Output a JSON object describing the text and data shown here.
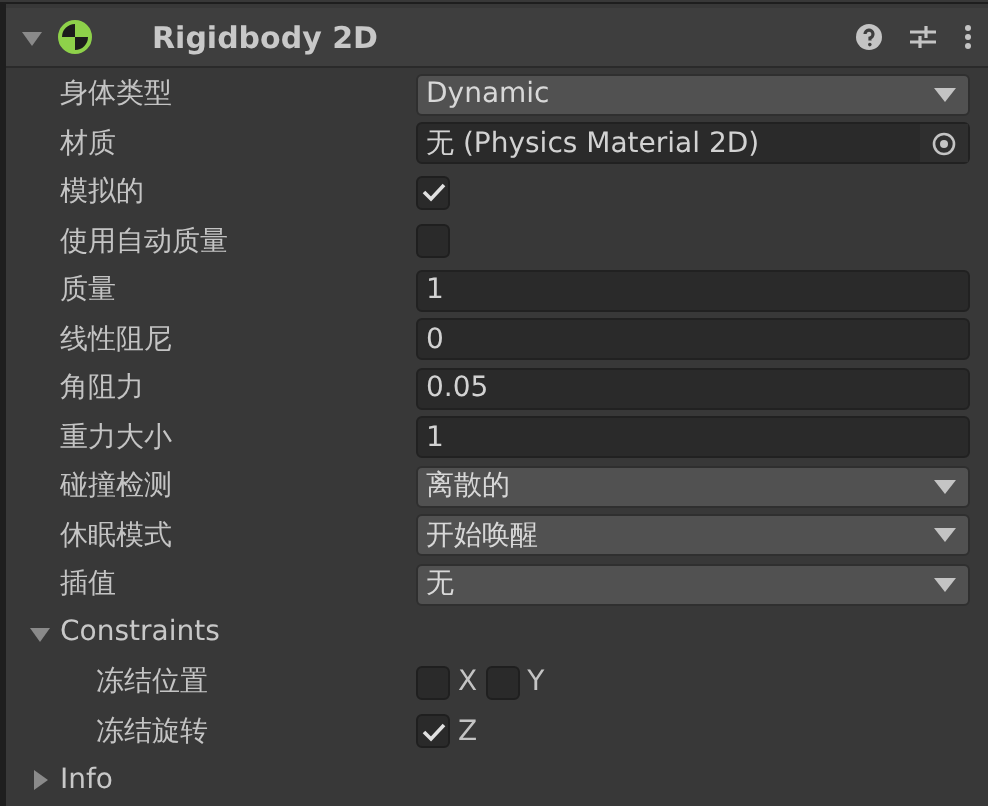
{
  "component": {
    "title": "Rigidbody 2D",
    "expanded": true
  },
  "properties": [
    {
      "kind": "dropdown",
      "label": "身体类型",
      "value": "Dynamic"
    },
    {
      "kind": "object",
      "label": "材质",
      "value": "无 (Physics Material 2D)"
    },
    {
      "kind": "checkbox",
      "label": "模拟的",
      "checked": true
    },
    {
      "kind": "checkbox",
      "label": "使用自动质量",
      "checked": false
    },
    {
      "kind": "number",
      "label": "质量",
      "value": "1"
    },
    {
      "kind": "number",
      "label": "线性阻尼",
      "value": "0"
    },
    {
      "kind": "number",
      "label": "角阻力",
      "value": "0.05"
    },
    {
      "kind": "number",
      "label": "重力大小",
      "value": "1"
    },
    {
      "kind": "dropdown",
      "label": "碰撞检测",
      "value": "离散的"
    },
    {
      "kind": "dropdown",
      "label": "休眠模式",
      "value": "开始唤醒"
    },
    {
      "kind": "dropdown",
      "label": "插值",
      "value": "无"
    }
  ],
  "constraints": {
    "label": "Constraints",
    "expanded": true,
    "rows": [
      {
        "label": "冻结位置",
        "axes": [
          {
            "label": "X",
            "checked": false
          },
          {
            "label": "Y",
            "checked": false
          }
        ]
      },
      {
        "label": "冻结旋转",
        "axes": [
          {
            "label": "Z",
            "checked": true
          }
        ]
      }
    ]
  },
  "info": {
    "label": "Info",
    "expanded": false
  }
}
